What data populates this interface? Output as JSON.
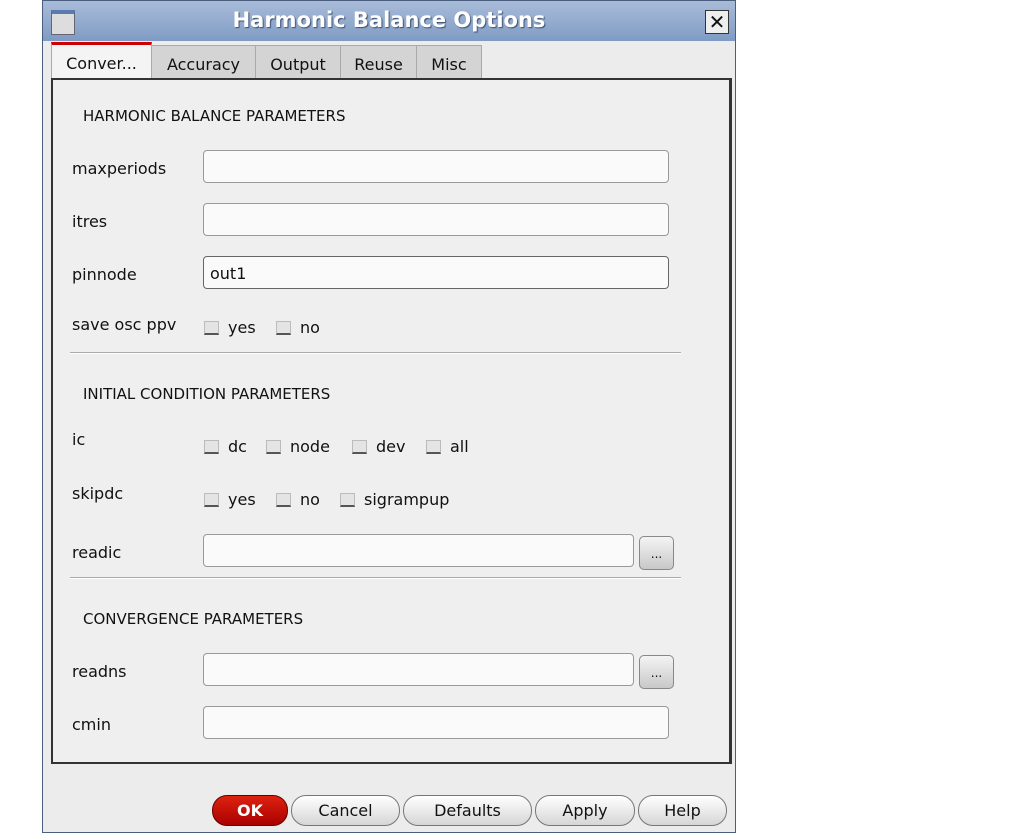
{
  "window": {
    "title": "Harmonic Balance Options"
  },
  "tabs": [
    {
      "label": "Conver..."
    },
    {
      "label": "Accuracy"
    },
    {
      "label": "Output"
    },
    {
      "label": "Reuse"
    },
    {
      "label": "Misc"
    }
  ],
  "sections": {
    "hb": "HARMONIC BALANCE PARAMETERS",
    "ic": "INITIAL CONDITION PARAMETERS",
    "conv": "CONVERGENCE PARAMETERS"
  },
  "fields": {
    "maxperiods": {
      "label": "maxperiods",
      "value": ""
    },
    "itres": {
      "label": "itres",
      "value": ""
    },
    "pinnode": {
      "label": "pinnode",
      "value": "out1"
    },
    "save_osc_ppv": {
      "label": "save osc ppv",
      "options": [
        "yes",
        "no"
      ]
    },
    "ic": {
      "label": "ic",
      "options": [
        "dc",
        "node",
        "dev",
        "all"
      ]
    },
    "skipdc": {
      "label": "skipdc",
      "options": [
        "yes",
        "no",
        "sigrampup"
      ]
    },
    "readic": {
      "label": "readic",
      "value": "",
      "browse": "..."
    },
    "readns": {
      "label": "readns",
      "value": "",
      "browse": "..."
    },
    "cmin": {
      "label": "cmin",
      "value": ""
    }
  },
  "buttons": {
    "ok": "OK",
    "cancel": "Cancel",
    "defaults": "Defaults",
    "apply": "Apply",
    "help": "Help"
  }
}
